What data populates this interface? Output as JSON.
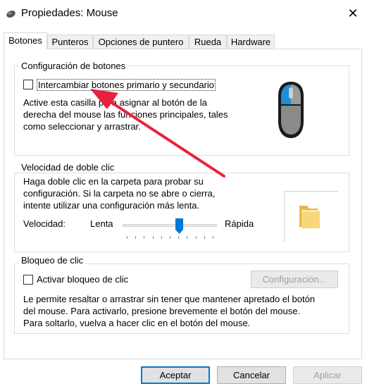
{
  "window": {
    "title": "Propiedades: Mouse",
    "close_glyph": "✕"
  },
  "tabs": [
    {
      "label": "Botones",
      "active": true
    },
    {
      "label": "Punteros",
      "active": false
    },
    {
      "label": "Opciones de puntero",
      "active": false
    },
    {
      "label": "Rueda",
      "active": false
    },
    {
      "label": "Hardware",
      "active": false
    }
  ],
  "button_config": {
    "title": "Configuración de botones",
    "swap_checkbox_label": "Intercambiar botones primario y secundario",
    "swap_checked": false,
    "description_lines": [
      "Active esta casilla para asignar al botón de la",
      "derecha del mouse las funciones principales, tales",
      "como seleccionar y arrastrar."
    ],
    "mouse_icon": "mouse-icon"
  },
  "double_click": {
    "title": "Velocidad de doble clic",
    "description_lines": [
      "Haga doble clic en la carpeta para probar su",
      "configuración. Si la carpeta no se abre o cierra,",
      "intente utilizar una configuración más lenta."
    ],
    "speed_label": "Velocidad:",
    "slow_label": "Lenta",
    "fast_label": "Rápida",
    "slider_value": 0.6,
    "folder_icon": "folder-icon"
  },
  "click_lock": {
    "title": "Bloqueo de clic",
    "checkbox_label": "Activar bloqueo de clic",
    "checked": false,
    "settings_button": "Configuración...",
    "description_lines": [
      "Le permite resaltar o arrastrar sin tener que mantener apretado el botón",
      "del mouse. Para activarlo, presione brevemente el botón del mouse.",
      "Para soltarlo, vuelva a hacer clic en el botón del mouse."
    ]
  },
  "footer": {
    "accept": "Aceptar",
    "cancel": "Cancelar",
    "apply": "Aplicar"
  },
  "annotation": {
    "arrow_color": "#e8213f"
  },
  "colors": {
    "focus_border": "#0078d7",
    "slider_thumb": "#0078d7",
    "mouse_accent": "#1e8fd6"
  }
}
